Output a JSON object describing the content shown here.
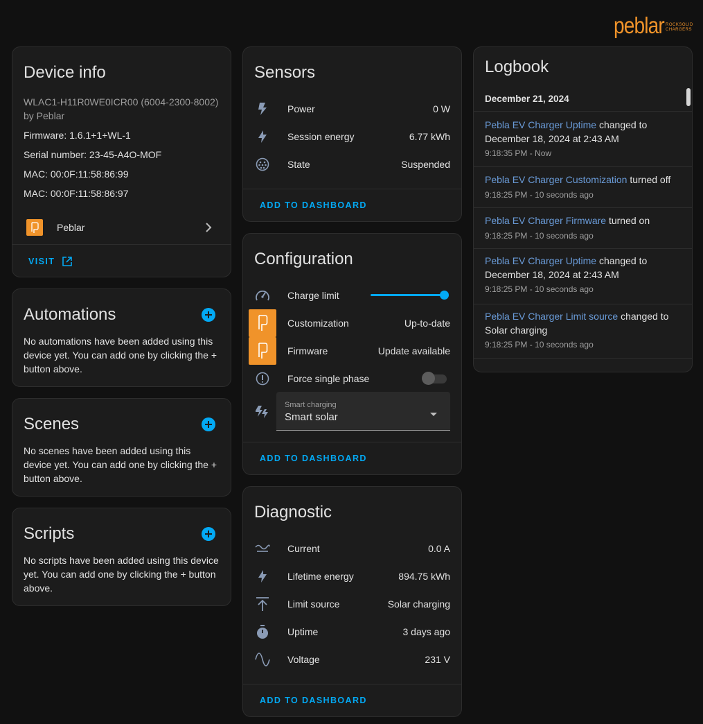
{
  "logo": {
    "word": "peblar",
    "tagline_1": "ROCKSOLID",
    "tagline_2": "CHARGERS"
  },
  "colors": {
    "accent": "#03a9f4",
    "brand": "#f0932a",
    "card": "#1c1c1c",
    "background": "#111111"
  },
  "device_info": {
    "title": "Device info",
    "model": "WLAC1-H11R0WE0ICR00 (6004-2300-8002)",
    "by": "by Peblar",
    "firmware": "Firmware: 1.6.1+1+WL-1",
    "serial": "Serial number: 23-45-A4O-MOF",
    "mac1": "MAC: 00:0F:11:58:86:99",
    "mac2": "MAC: 00:0F:11:58:86:97",
    "integration": "Peblar",
    "visit": "VISIT"
  },
  "automations": {
    "title": "Automations",
    "text": "No automations have been added using this device yet. You can add one by clicking the + button above."
  },
  "scenes": {
    "title": "Scenes",
    "text": "No scenes have been added using this device yet. You can add one by clicking the + button above."
  },
  "scripts": {
    "title": "Scripts",
    "text": "No scripts have been added using this device yet. You can add one by clicking the + button above."
  },
  "sensors": {
    "title": "Sensors",
    "rows": [
      {
        "icon": "lightning-bolt-outline-icon",
        "label": "Power",
        "value": "0 W"
      },
      {
        "icon": "lightning-bolt-icon",
        "label": "Session energy",
        "value": "6.77 kWh"
      },
      {
        "icon": "ev-plug-icon",
        "label": "State",
        "value": "Suspended"
      }
    ],
    "add": "ADD TO DASHBOARD"
  },
  "configuration": {
    "title": "Configuration",
    "charge_limit_label": "Charge limit",
    "charge_limit_fraction": 1.0,
    "customization_label": "Customization",
    "customization_value": "Up-to-date",
    "firmware_label": "Firmware",
    "firmware_value": "Update available",
    "force_label": "Force single phase",
    "force_on": false,
    "select_label": "Smart charging",
    "select_value": "Smart solar",
    "add": "ADD TO DASHBOARD"
  },
  "diagnostic": {
    "title": "Diagnostic",
    "rows": [
      {
        "icon": "current-ac-icon",
        "label": "Current",
        "value": "0.0 A"
      },
      {
        "icon": "lightning-bolt-icon",
        "label": "Lifetime energy",
        "value": "894.75 kWh"
      },
      {
        "icon": "arrow-collapse-up-icon",
        "label": "Limit source",
        "value": "Solar charging"
      },
      {
        "icon": "timer-icon",
        "label": "Uptime",
        "value": "3 days ago"
      },
      {
        "icon": "sine-wave-icon",
        "label": "Voltage",
        "value": "231 V"
      }
    ],
    "add": "ADD TO DASHBOARD"
  },
  "logbook": {
    "title": "Logbook",
    "date": "December 21, 2024",
    "entries": [
      {
        "entity": "Pebla EV Charger Uptime",
        "action": " changed to",
        "line2": "December 18, 2024 at 2:43 AM",
        "time": "9:18:35 PM - Now"
      },
      {
        "entity": "Pebla EV Charger Customization",
        "action": " turned off",
        "line2": "",
        "time": "9:18:25 PM - 10 seconds ago"
      },
      {
        "entity": "Pebla EV Charger Firmware",
        "action": " turned on",
        "line2": "",
        "time": "9:18:25 PM - 10 seconds ago"
      },
      {
        "entity": "Pebla EV Charger Uptime",
        "action": " changed to",
        "line2": "December 18, 2024 at 2:43 AM",
        "time": "9:18:25 PM - 10 seconds ago"
      },
      {
        "entity": "Pebla EV Charger Limit source",
        "action": " changed to",
        "line2": "Solar charging",
        "time": "9:18:25 PM - 10 seconds ago"
      }
    ]
  }
}
